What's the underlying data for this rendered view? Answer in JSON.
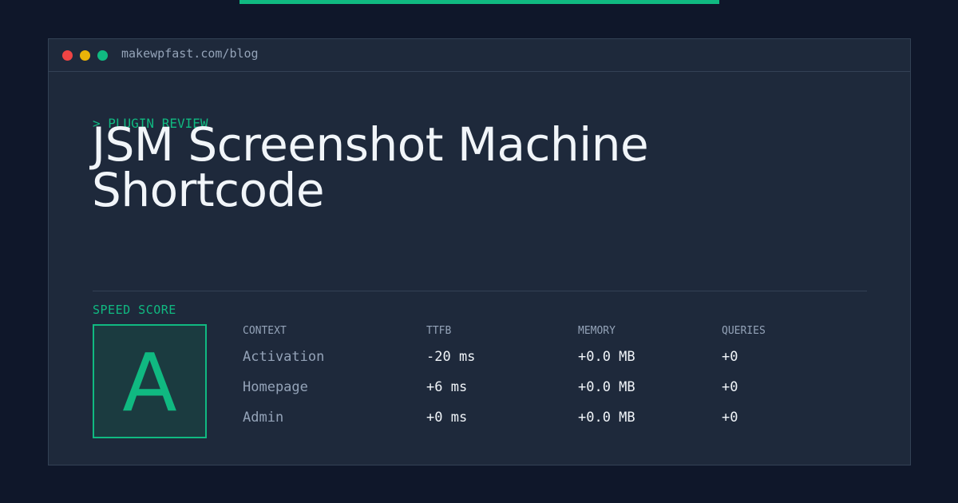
{
  "window": {
    "url": "makewpfast.com/blog"
  },
  "article": {
    "section_label": "> PLUGIN REVIEW",
    "title_line1": "JSM Screenshot Machine",
    "title_line2": "Shortcode"
  },
  "speed": {
    "label": "SPEED SCORE",
    "grade": "A"
  },
  "metrics": {
    "headers": [
      "CONTEXT",
      "TTFB",
      "MEMORY",
      "QUERIES"
    ],
    "rows": [
      [
        "Activation",
        "-20 ms",
        "+0.0 MB",
        "+0"
      ],
      [
        "Homepage",
        "+6 ms",
        "+0.0 MB",
        "+0"
      ],
      [
        "Admin",
        "+0 ms",
        "+0.0 MB",
        "+0"
      ]
    ]
  },
  "colors": {
    "accent": "#10b981",
    "background": "#0f172a",
    "panel": "#1e293b"
  }
}
